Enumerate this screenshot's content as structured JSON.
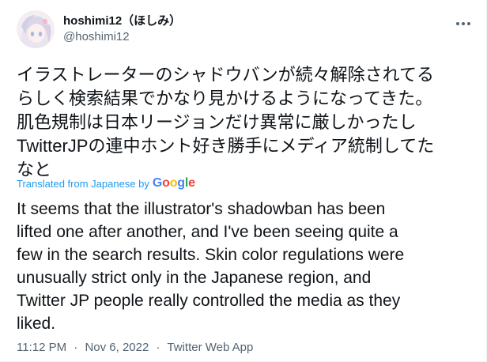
{
  "author": {
    "display_name": "hoshimi12（ほしみ）",
    "handle": "@hoshimi12"
  },
  "tweet": {
    "original_lines": [
      "イラストレーターのシャドウバンが続々解除されてる",
      "らしく検索結果でかなり見かけるようになってきた。",
      "肌色規制は日本リージョンだけ異常に厳しかったし",
      "TwitterJPの連中ホント好き勝手にメディア統制してた",
      "なと"
    ],
    "translated_from": "Translated from Japanese by",
    "translator": "Google",
    "translation_lines": [
      "It seems that the illustrator's shadowban has been",
      "lifted one after another, and I've been seeing quite a",
      "few in the search results. Skin color regulations were",
      "unusually strict only in the Japanese region, and",
      "Twitter JP people really controlled the media as they",
      "liked."
    ],
    "time": "11:12 PM",
    "separator": "·",
    "date": "Nov 6, 2022",
    "source": "Twitter Web App"
  },
  "google_colors": [
    "#4285F4",
    "#EA4335",
    "#FBBC05",
    "#4285F4",
    "#34A853",
    "#EA4335"
  ],
  "icons": {
    "more": "more-dots-icon"
  }
}
